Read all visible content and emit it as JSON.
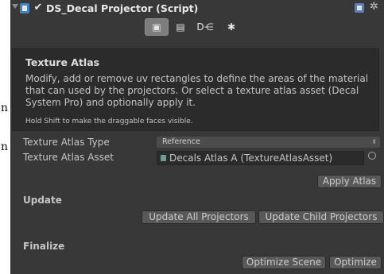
{
  "background_fragments": [
    "n",
    "n"
  ],
  "component": {
    "title": "DS_Decal Projector (Script)",
    "enabled": "✔"
  },
  "toolbar": {
    "tools": [
      {
        "icon": "projector-icon",
        "glyph": "▣"
      },
      {
        "icon": "document-icon",
        "glyph": "▤"
      },
      {
        "icon": "decal-tool-icon",
        "glyph": "D⋲"
      },
      {
        "icon": "settings-gear-icon",
        "glyph": "✱"
      }
    ]
  },
  "info": {
    "title": "Texture Atlas",
    "body": "Modify, add or remove uv rectangles to define the areas of the material that can used by the projectors. Or select a texture atlas asset (Decal System Pro) and optionally apply it.",
    "hint": "Hold Shift to make the draggable faces visible."
  },
  "fields": {
    "atlas_type_label": "Texture Atlas Type",
    "atlas_type_value": "Reference",
    "atlas_asset_label": "Texture Atlas Asset",
    "atlas_asset_value": "Decals Atlas A (TextureAtlasAsset)"
  },
  "buttons": {
    "apply_atlas": "Apply Atlas",
    "update_all": "Update All Projectors",
    "update_child": "Update Child Projectors",
    "optimize_scene": "Optimize Scene",
    "optimize": "Optimize"
  },
  "sections": {
    "update": "Update",
    "finalize": "Finalize"
  },
  "colors": {
    "panel_bg": "#383838",
    "infobox_bg": "#2b2b2b",
    "button_bg": "#585858",
    "active_tool_bg": "#7d7d7d"
  }
}
